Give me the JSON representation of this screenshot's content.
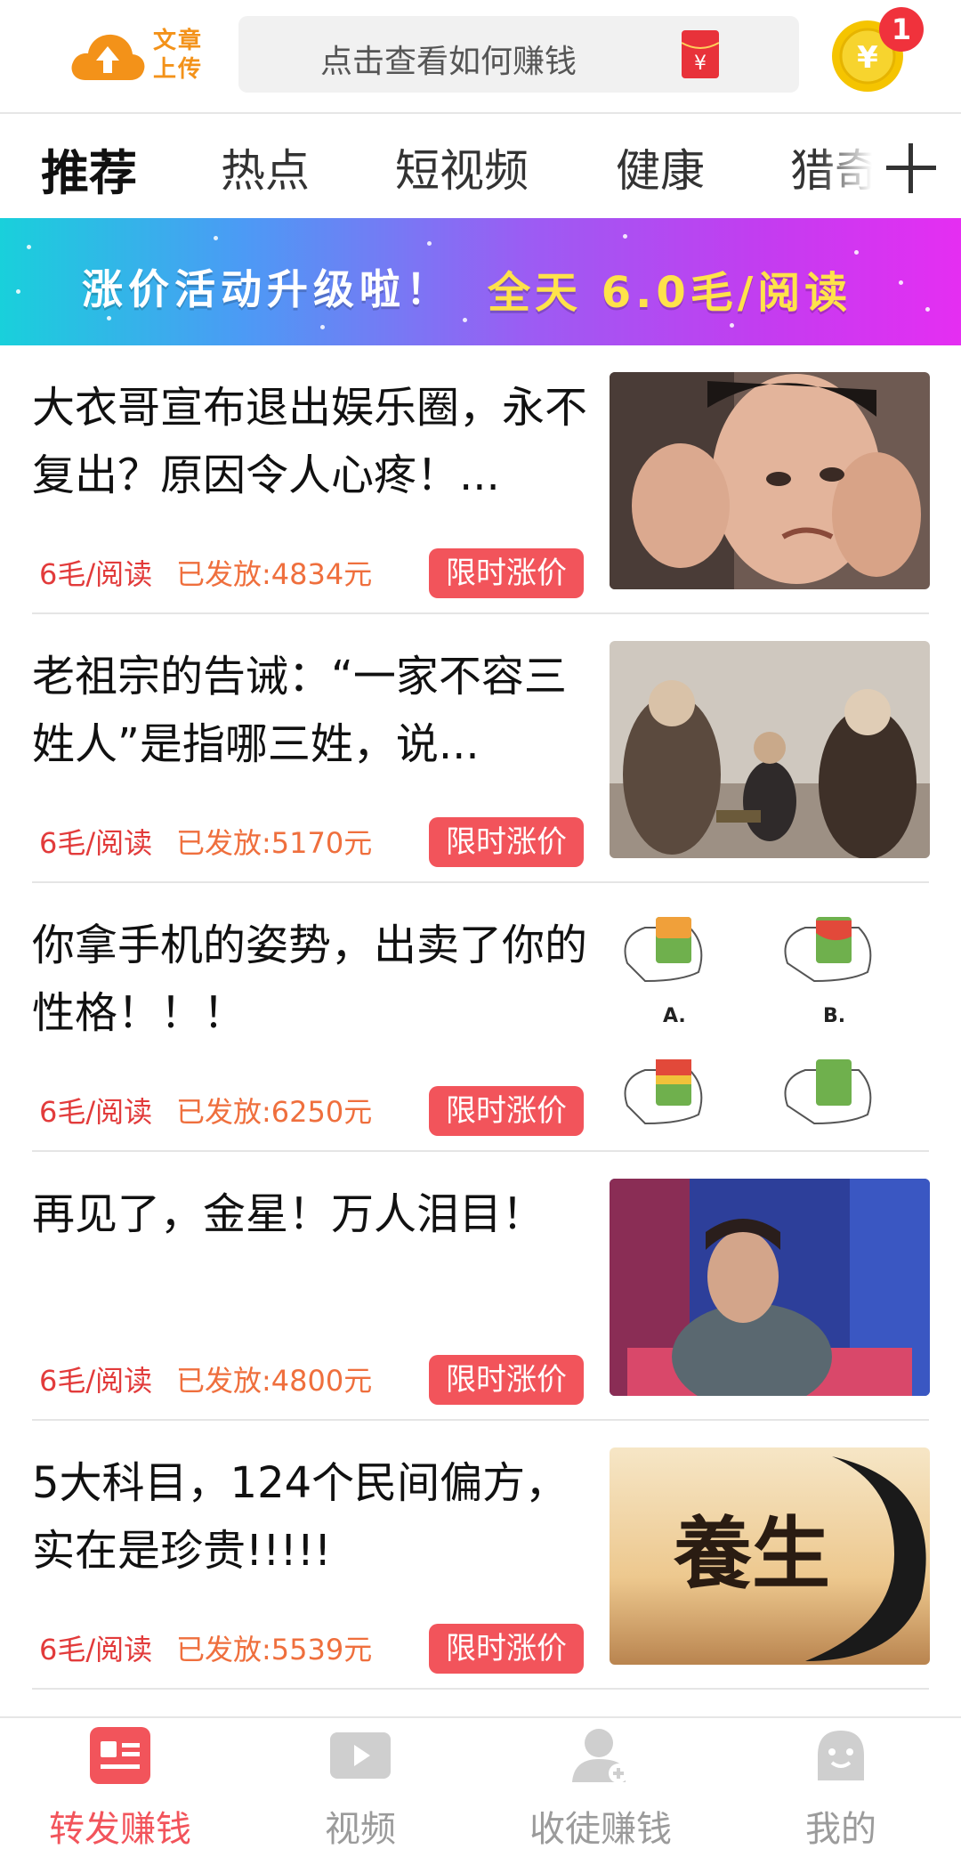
{
  "header": {
    "upload_label_line1": "文章",
    "upload_label_line2": "上传",
    "search_placeholder": "点击查看如何赚钱",
    "coin_symbol": "¥",
    "notification_count": "1"
  },
  "tabs": [
    {
      "label": "推荐",
      "active": true
    },
    {
      "label": "热点",
      "active": false
    },
    {
      "label": "短视频",
      "active": false
    },
    {
      "label": "健康",
      "active": false
    },
    {
      "label": "猎奇",
      "active": false
    }
  ],
  "banner": {
    "text_main": "涨价活动升级啦！",
    "text_highlight": "全天 6.0毛/阅读"
  },
  "articles": [
    {
      "title": "大衣哥宣布退出娱乐圈，永不复出？原因令人心疼！...",
      "rate": "6毛/阅读",
      "paid": "已发放:4834元",
      "promo": "限时涨价"
    },
    {
      "title": "老祖宗的告诫：“一家不容三姓人”是指哪三姓，说...",
      "rate": "6毛/阅读",
      "paid": "已发放:5170元",
      "promo": "限时涨价"
    },
    {
      "title": "你拿手机的姿势，出卖了你的性格！！！",
      "rate": "6毛/阅读",
      "paid": "已发放:6250元",
      "promo": "限时涨价",
      "thumb_labels": [
        "A.",
        "B."
      ]
    },
    {
      "title": "再见了，金星！万人泪目！",
      "rate": "6毛/阅读",
      "paid": "已发放:4800元",
      "promo": "限时涨价"
    },
    {
      "title": "5大科目，124个民间偏方，实在是珍贵!!!!!",
      "rate": "6毛/阅读",
      "paid": "已发放:5539元",
      "promo": "限时涨价",
      "thumb_text": "養生"
    }
  ],
  "bottom_nav": [
    {
      "label": "转发赚钱",
      "icon": "article-icon",
      "active": true
    },
    {
      "label": "视频",
      "icon": "video-icon",
      "active": false
    },
    {
      "label": "收徒赚钱",
      "icon": "add-user-icon",
      "active": false
    },
    {
      "label": "我的",
      "icon": "profile-face-icon",
      "active": false
    }
  ],
  "colors": {
    "accent_red": "#f2545b",
    "upload_orange": "#f39219",
    "coin_yellow": "#f5c400",
    "badge_red": "#f0323c"
  }
}
